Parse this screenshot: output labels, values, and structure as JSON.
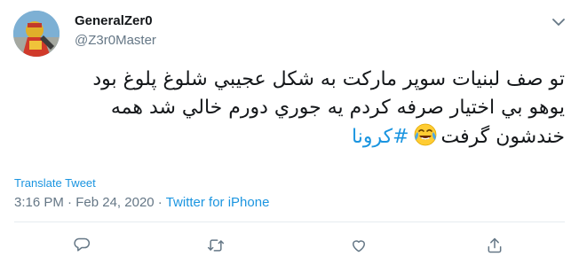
{
  "user": {
    "display_name": "GeneralZer0",
    "handle": "@Z3r0Master"
  },
  "tweet": {
    "lines": [
      "تو صف لبنیات سوپر مارکت به شکل عجیبي شلوغ پلوغ بود",
      "یوهو بي اختیار صرفه کردم یه جوري دورم خالي شد همه",
      "خندشون گرفت"
    ],
    "emoji": "face-with-tears-of-joy",
    "hashtag": "#کرونا"
  },
  "translate_label": "Translate Tweet",
  "meta": {
    "time": "3:16 PM",
    "separator": " · ",
    "date": "Feb 24, 2020",
    "source": "Twitter for iPhone"
  },
  "colors": {
    "link": "#1b95e0",
    "secondary": "#657786",
    "divider": "#e6ecf0"
  },
  "icons": [
    "caret-down-icon",
    "reply-icon",
    "retweet-icon",
    "like-icon",
    "share-icon"
  ]
}
